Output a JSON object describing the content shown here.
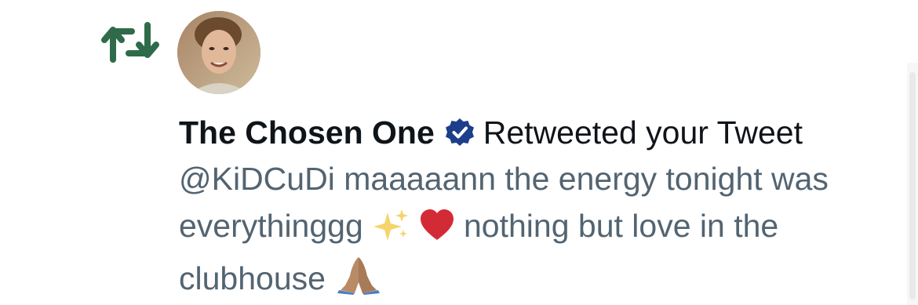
{
  "notification": {
    "type_icon": "retweet-icon",
    "icon_color": "#2f6b4a",
    "avatar": "user-avatar",
    "user_name": "The Chosen One",
    "verified": true,
    "verified_color": "#1d3e8a",
    "action_text": "Retweeted your Tweet",
    "tweet": {
      "mention": "@KiDCuDi",
      "text_part1": "maaaaann the energy tonight was everythinggg",
      "emoji_sparkles": "✨",
      "emoji_heart": "❤️",
      "text_part2": "nothing but love in the clubhouse",
      "emoji_pray": "🙏"
    }
  }
}
